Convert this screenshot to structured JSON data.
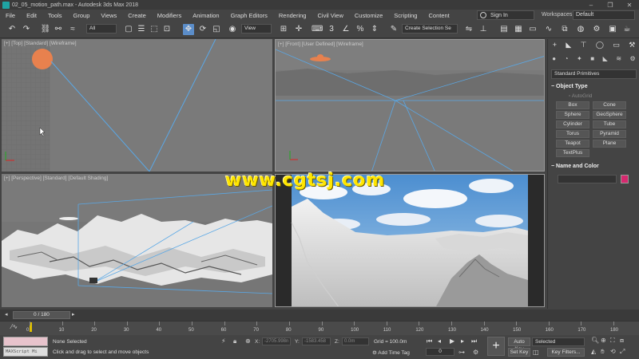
{
  "window": {
    "title": "02_05_motion_path.max - Autodesk 3ds Max 2018",
    "controls": [
      "–",
      "❐",
      "✕"
    ]
  },
  "menu": [
    "File",
    "Edit",
    "Tools",
    "Group",
    "Views",
    "Create",
    "Modifiers",
    "Animation",
    "Graph Editors",
    "Rendering",
    "Civil View",
    "Customize",
    "Scripting",
    "Content"
  ],
  "account": {
    "sign_in": "Sign In",
    "workspaces_label": "Workspaces:",
    "workspace_value": "Default"
  },
  "toolbar": {
    "filter_value": "All",
    "reference_coord": "View",
    "selection_set": "Create Selection Se"
  },
  "viewports": {
    "top_label": "[+] [Top] [Standard] [Wireframe]",
    "front_label": "[+] [Front] [User Defined] [Wireframe]",
    "perspective_label": "[+] [Perspective] [Standard] [Default Shading]",
    "camera_label": ""
  },
  "command_panel": {
    "category": "Standard Primitives",
    "object_type_title": "Object Type",
    "autogrid": "AutoGrid",
    "primitives": [
      "Box",
      "Cone",
      "Sphere",
      "GeoSphere",
      "Cylinder",
      "Tube",
      "Torus",
      "Pyramid",
      "Teapot",
      "Plane",
      "TextPlus"
    ],
    "name_color_title": "Name and Color",
    "object_color": "#d6296f"
  },
  "timeline": {
    "frame_display": "0 / 180",
    "ticks": [
      "0",
      "10",
      "20",
      "30",
      "40",
      "50",
      "60",
      "70",
      "80",
      "90",
      "100",
      "110",
      "120",
      "130",
      "140",
      "150",
      "160",
      "170",
      "180"
    ]
  },
  "status": {
    "maxscript_label": "MAXScript Mi",
    "selection": "None Selected",
    "prompt": "Click and drag to select and move objects",
    "x_label": "X:",
    "x_value": "-2705.998n",
    "y_label": "Y:",
    "y_value": "-1583.458",
    "z_label": "Z:",
    "z_value": "0.0m",
    "grid": "Grid = 100.0m",
    "add_time_tag": "Add Time Tag",
    "current_frame": "0",
    "auto_key": "Auto Key",
    "set_key": "Set Key",
    "key_mode": "Selected",
    "key_filters": "Key Filters..."
  },
  "watermark": "www.cgtsj.com"
}
